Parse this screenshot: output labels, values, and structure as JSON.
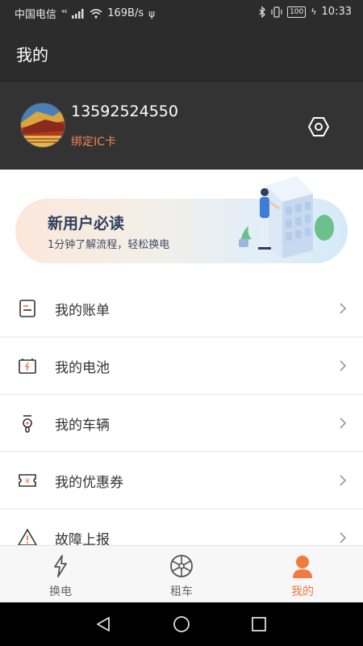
{
  "status_bar": {
    "carrier": "中国电信",
    "network": "⁴⁶",
    "speed": "169B/s",
    "usb": "ψ",
    "battery": "100",
    "time": "10:33"
  },
  "header": {
    "title": "我的"
  },
  "profile": {
    "phone": "13592524550",
    "bind_ic_label": "绑定IC卡"
  },
  "banner": {
    "title": "新用户必读",
    "subtitle": "1分钟了解流程，轻松换电"
  },
  "menu": {
    "items": [
      {
        "label": "我的账单",
        "icon": "bill-icon"
      },
      {
        "label": "我的电池",
        "icon": "battery-icon"
      },
      {
        "label": "我的车辆",
        "icon": "scooter-icon"
      },
      {
        "label": "我的优惠券",
        "icon": "coupon-icon"
      },
      {
        "label": "故障上报",
        "icon": "warning-icon"
      }
    ]
  },
  "tabs": [
    {
      "label": "换电",
      "icon": "lightning-icon",
      "active": false
    },
    {
      "label": "租车",
      "icon": "wheel-icon",
      "active": false
    },
    {
      "label": "我的",
      "icon": "user-icon",
      "active": true
    }
  ],
  "colors": {
    "accent": "#f07a3f",
    "header_bg": "#2c2c2c",
    "profile_bg": "#333333"
  }
}
